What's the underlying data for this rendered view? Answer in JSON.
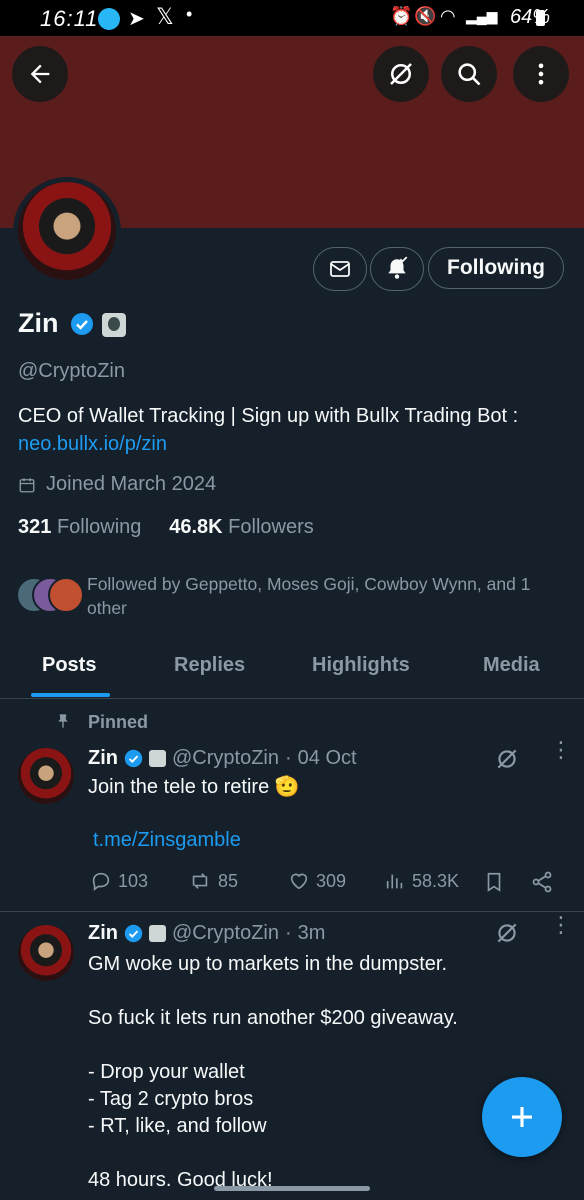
{
  "status": {
    "time": "16:11",
    "battery": "64%"
  },
  "profile": {
    "name": "Zin",
    "handle": "@CryptoZin",
    "bio_text": "CEO of Wallet Tracking |  Sign up with Bullx Trading Bot :",
    "bio_link": "neo.bullx.io/p/zin",
    "joined": "Joined March 2024",
    "following_count": "321",
    "following_label": "Following",
    "followers_count": "46.8K",
    "followers_label": "Followers",
    "followed_by": "Followed by Geppetto, Moses Goji, Cowboy Wynn, and 1 other",
    "follow_button": "Following"
  },
  "tabs": [
    "Posts",
    "Replies",
    "Highlights",
    "Media"
  ],
  "posts": [
    {
      "pinned_label": "Pinned",
      "name": "Zin",
      "handle": "@CryptoZin",
      "time": "04 Oct",
      "text": "Join the tele to retire 🫡",
      "link": "t.me/Zinsgamble",
      "replies": "103",
      "reposts": "85",
      "likes": "309",
      "views": "58.3K"
    },
    {
      "name": "Zin",
      "handle": "@CryptoZin",
      "time": "3m",
      "text": "GM woke up to markets in the dumpster.\n\nSo fuck it lets run another $200 giveaway.\n\n- Drop your wallet\n- Tag 2 crypto bros\n- RT, like, and follow\n\n48 hours. Good luck!"
    }
  ],
  "colors": {
    "accent": "#1d9bf0",
    "background": "#15202b",
    "banner": "#5a1d1b"
  }
}
